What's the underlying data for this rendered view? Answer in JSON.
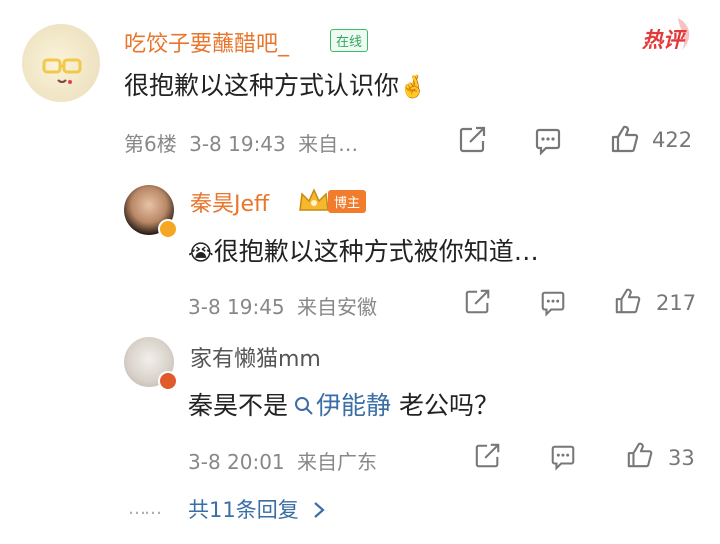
{
  "hot_label": "热评",
  "comment1": {
    "username": "吃饺子要蘸醋吧_",
    "online_badge": "在线",
    "text": "很抱歉以这种方式认识你",
    "emoji": "🤞",
    "floor": "第6楼",
    "time": "3-8 19:43",
    "source": "来自…",
    "likes": "422"
  },
  "reply1": {
    "username": "秦昊Jeff",
    "blogger_badge": "博主",
    "emoji": "😭",
    "text": "很抱歉以这种方式被你知道…",
    "time": "3-8 19:45",
    "source": "来自安徽",
    "likes": "217"
  },
  "reply2": {
    "username": "家有懒猫mm",
    "text_before": "秦昊不是",
    "link_text": "伊能静",
    "text_after": " 老公吗？",
    "time": "3-8 20:01",
    "source": "来自广东",
    "likes": "33"
  },
  "more_replies": {
    "dots": "……",
    "label": "共11条回复"
  }
}
